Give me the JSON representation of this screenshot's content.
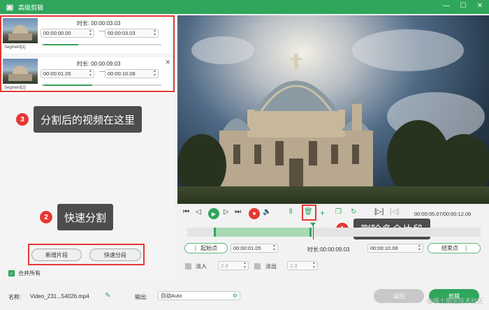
{
  "titlebar": {
    "title": "高级剪辑",
    "logo": "㈱",
    "minimize": "—",
    "maximize": "☐",
    "close": "✕"
  },
  "segments": [
    {
      "name": "Segment[1]",
      "dur_label": "时长:",
      "duration": "00:00:03.03",
      "start": "00:00:00.00",
      "end": "00:00:03.03",
      "closable": false
    },
    {
      "name": "Segment[2]",
      "dur_label": "时长:",
      "duration": "00:00:09.03",
      "start": "00:00:01.05",
      "end": "00:00:10.08",
      "closable": true
    }
  ],
  "callouts": {
    "c1": {
      "num": "1",
      "text": "删除多余片段"
    },
    "c2": {
      "num": "2",
      "text": "快速分割"
    },
    "c3": {
      "num": "3",
      "text": "分割后的视频在这里"
    }
  },
  "left_buttons": {
    "new_segment": "新增片段",
    "quick_split": "快速分段"
  },
  "merge_all": {
    "label": "合并所有",
    "checked": true
  },
  "playback": {
    "time": "00:00:05.07/00:00:12.06"
  },
  "range": {
    "start_label": "起始点",
    "start_value": "00:00:01.05",
    "dur_label": "时长:",
    "duration": "00:00:09.03",
    "end_value": "00:00:10.08",
    "end_label": "结束点"
  },
  "fade": {
    "in_label": "淡入",
    "in_value": "2.3",
    "out_label": "淡出",
    "out_value": "2.3"
  },
  "footer": {
    "name_label": "名称:",
    "name_value": "Video_231...54026.mp4",
    "output_label": "输出:",
    "output_value": "自动Auto",
    "back_label": "返回",
    "cut_label": "剪辑"
  },
  "watermark": "@稀土掘金技术社区",
  "colors": {
    "accent": "#2fa65c",
    "annotation": "#e53935",
    "callout_bg": "#4d4d4d"
  }
}
